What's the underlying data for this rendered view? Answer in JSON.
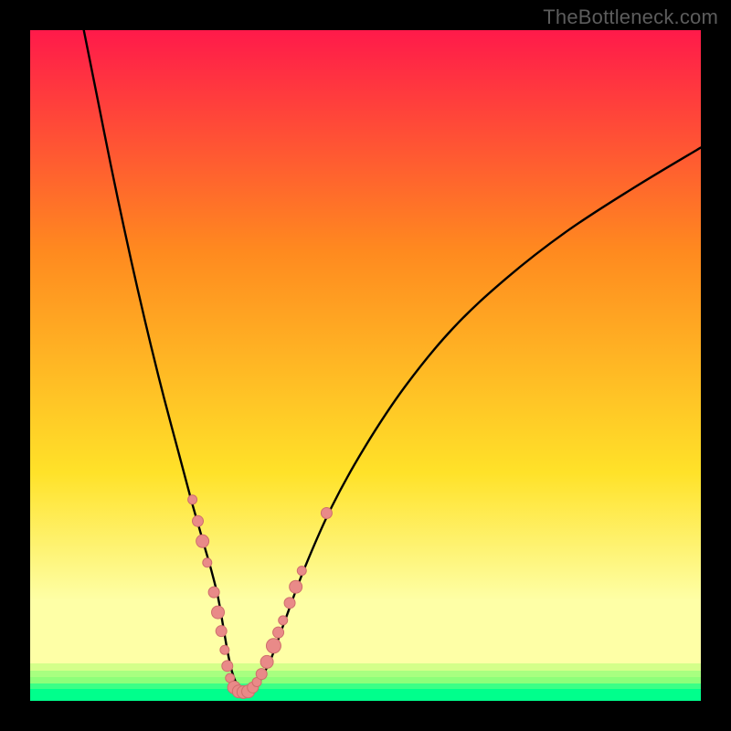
{
  "watermark": "TheBottleneck.com",
  "colors": {
    "top": "#ff1a4a",
    "mid_upper": "#ff8a1f",
    "mid": "#ffe229",
    "band_pale": "#feffa6",
    "band_light_green": "#d4ff8a",
    "band_green1": "#8dff7a",
    "band_green2": "#3cff86",
    "band_green3": "#00ff8c",
    "curve": "#000000",
    "marker_fill": "#e98a88",
    "marker_stroke": "#cf6e6c"
  },
  "chart_data": {
    "type": "line",
    "title": "",
    "xlabel": "",
    "ylabel": "",
    "xlim": [
      0,
      100
    ],
    "ylim": [
      0,
      100
    ],
    "curve": {
      "x": [
        8,
        10,
        12,
        14,
        16,
        18,
        20,
        22,
        24,
        25,
        26,
        27,
        28,
        28.8,
        29.5,
        30.2,
        31,
        32,
        33,
        34,
        36,
        38,
        41,
        45,
        50,
        56,
        63,
        71,
        80,
        90,
        100
      ],
      "y": [
        100,
        90,
        80,
        70.5,
        61.5,
        53,
        45,
        37.5,
        30,
        26.5,
        23,
        19.5,
        15.5,
        11,
        7,
        4,
        2.2,
        1.3,
        1.3,
        2.5,
        6.5,
        12,
        20,
        29,
        38,
        47,
        55.5,
        63,
        70,
        76.5,
        82.5
      ]
    },
    "markers": [
      {
        "x": 24.2,
        "y": 30.0,
        "r": 5
      },
      {
        "x": 25.0,
        "y": 26.8,
        "r": 6
      },
      {
        "x": 25.7,
        "y": 23.8,
        "r": 7
      },
      {
        "x": 26.4,
        "y": 20.6,
        "r": 5
      },
      {
        "x": 27.4,
        "y": 16.2,
        "r": 6
      },
      {
        "x": 28.0,
        "y": 13.2,
        "r": 7
      },
      {
        "x": 28.5,
        "y": 10.4,
        "r": 6
      },
      {
        "x": 29.0,
        "y": 7.6,
        "r": 5
      },
      {
        "x": 29.4,
        "y": 5.2,
        "r": 6
      },
      {
        "x": 29.8,
        "y": 3.4,
        "r": 5
      },
      {
        "x": 30.4,
        "y": 2.0,
        "r": 7
      },
      {
        "x": 31.1,
        "y": 1.4,
        "r": 7
      },
      {
        "x": 31.8,
        "y": 1.3,
        "r": 7
      },
      {
        "x": 32.5,
        "y": 1.4,
        "r": 7
      },
      {
        "x": 33.2,
        "y": 2.0,
        "r": 6
      },
      {
        "x": 33.8,
        "y": 2.8,
        "r": 5
      },
      {
        "x": 34.5,
        "y": 4.0,
        "r": 6
      },
      {
        "x": 35.3,
        "y": 5.8,
        "r": 7
      },
      {
        "x": 36.3,
        "y": 8.2,
        "r": 8
      },
      {
        "x": 37.0,
        "y": 10.2,
        "r": 6
      },
      {
        "x": 37.7,
        "y": 12.0,
        "r": 5
      },
      {
        "x": 38.7,
        "y": 14.6,
        "r": 6
      },
      {
        "x": 39.6,
        "y": 17.0,
        "r": 7
      },
      {
        "x": 40.5,
        "y": 19.4,
        "r": 5
      },
      {
        "x": 44.2,
        "y": 28.0,
        "r": 6
      }
    ]
  }
}
